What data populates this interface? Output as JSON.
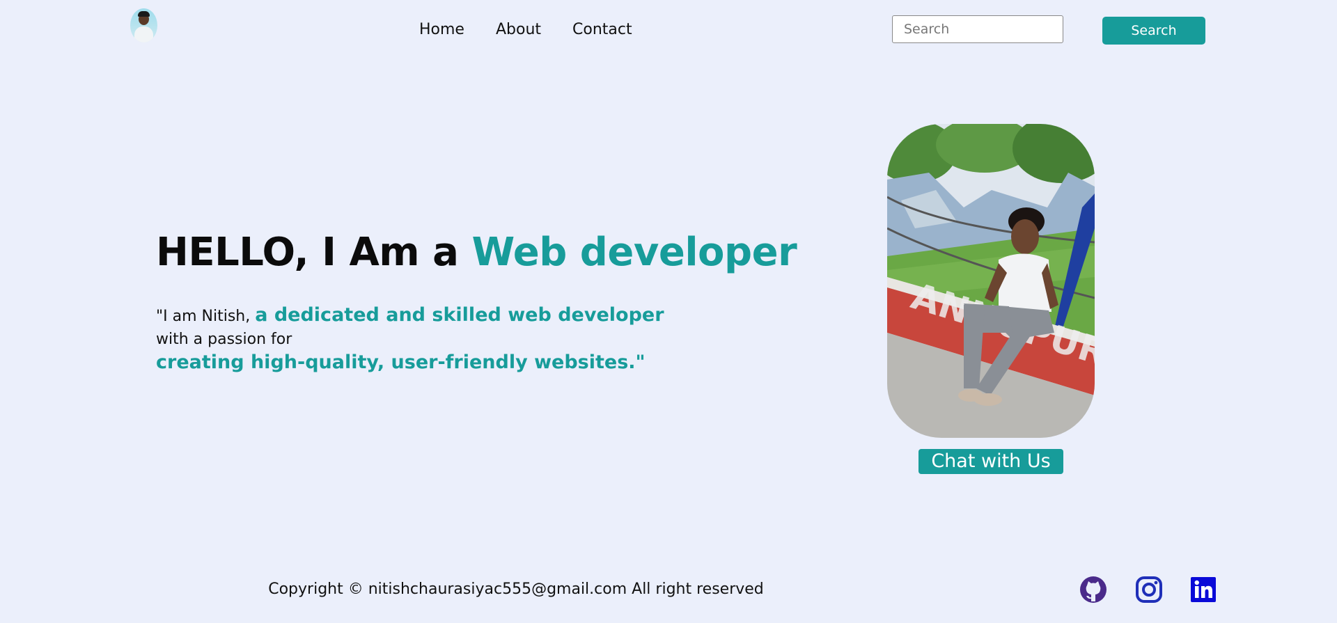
{
  "header": {
    "avatar_icon": "profile-avatar",
    "nav": [
      {
        "label": "Home"
      },
      {
        "label": "About"
      },
      {
        "label": "Contact"
      }
    ],
    "search": {
      "placeholder": "Search",
      "button_label": "Search"
    }
  },
  "hero": {
    "title_plain": "HELLO, I Am a ",
    "title_accent": "Web developer",
    "intro_line1_plain": "\"I am Nitish, ",
    "intro_line1_accent": "a dedicated and skilled web developer",
    "intro_line2": "with a passion for",
    "intro_line3": "creating high-quality, user-friendly websites.\"",
    "chat_button": "Chat with Us"
  },
  "footer": {
    "copyright": "Copyright © nitishchaurasiyac555@gmail.com All right reserved",
    "social_icons": [
      "github-icon",
      "instagram-icon",
      "linkedin-icon"
    ]
  },
  "colors": {
    "background": "#ebeffb",
    "accent": "#179c9a",
    "github": "#4a2a8a",
    "instagram": "#1f2fb8",
    "linkedin": "#0a0ad8"
  }
}
